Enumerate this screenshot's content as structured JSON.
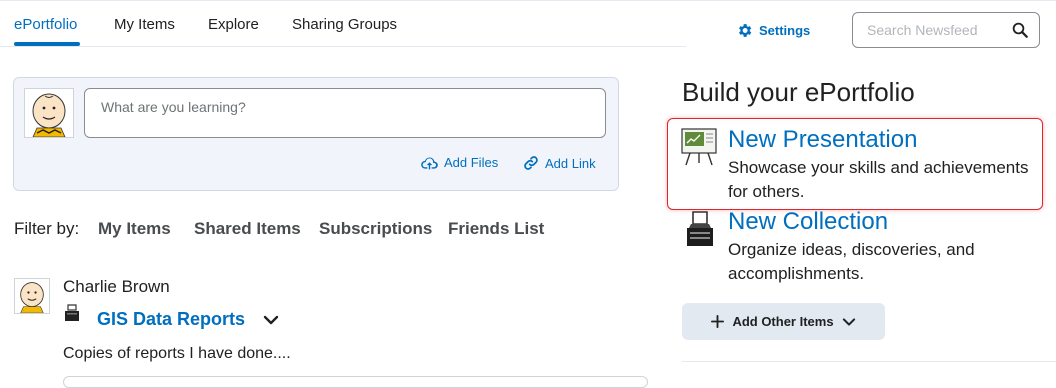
{
  "nav": {
    "tabs": [
      {
        "label": "ePortfolio",
        "active": true
      },
      {
        "label": "My Items"
      },
      {
        "label": "Explore"
      },
      {
        "label": "Sharing Groups"
      }
    ]
  },
  "header": {
    "settings_label": "Settings",
    "search_placeholder": "Search Newsfeed"
  },
  "composer": {
    "placeholder": "What are you learning?",
    "add_files_label": "Add Files",
    "add_link_label": "Add Link"
  },
  "filter": {
    "label": "Filter by:",
    "items": [
      "My Items",
      "Shared Items",
      "Subscriptions",
      "Friends List"
    ]
  },
  "feed": {
    "author": "Charlie Brown",
    "item_title": "GIS Data Reports",
    "item_desc": "Copies of reports I have done...."
  },
  "build": {
    "title": "Build your ePortfolio",
    "options": [
      {
        "title": "New Presentation",
        "desc": "Showcase your skills and achievements for others."
      },
      {
        "title": "New Collection",
        "desc": "Organize ideas, discoveries, and accomplishments."
      }
    ],
    "add_other_label": "Add Other Items"
  },
  "colors": {
    "accent": "#006fbf",
    "highlight": "#e3242b",
    "composer_bg": "#f1f5fb"
  }
}
